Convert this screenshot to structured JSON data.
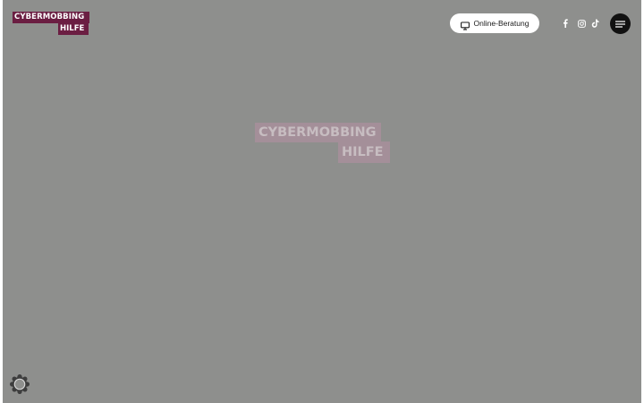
{
  "header": {
    "logo": {
      "line1": "CYBERMOBBING",
      "line2": "HILFE",
      "color": "#6b1e42"
    },
    "consult_button": {
      "label": "Online-Beratung",
      "icon": "monitor-icon"
    },
    "social_links": [
      {
        "name": "facebook",
        "icon": "facebook-icon"
      },
      {
        "name": "instagram",
        "icon": "instagram-icon"
      },
      {
        "name": "tiktok",
        "icon": "tiktok-icon"
      }
    ],
    "menu_button": {
      "icon": "hamburger-menu-icon"
    }
  },
  "loader": {
    "logo_line1": "CYBERMOBBING",
    "logo_line2": "HILFE"
  },
  "cookie_settings": {
    "icon": "gear-icon"
  },
  "colors": {
    "overlay": "#8e8f8d",
    "brand": "#6b1e42",
    "menu_button": "#111111"
  }
}
